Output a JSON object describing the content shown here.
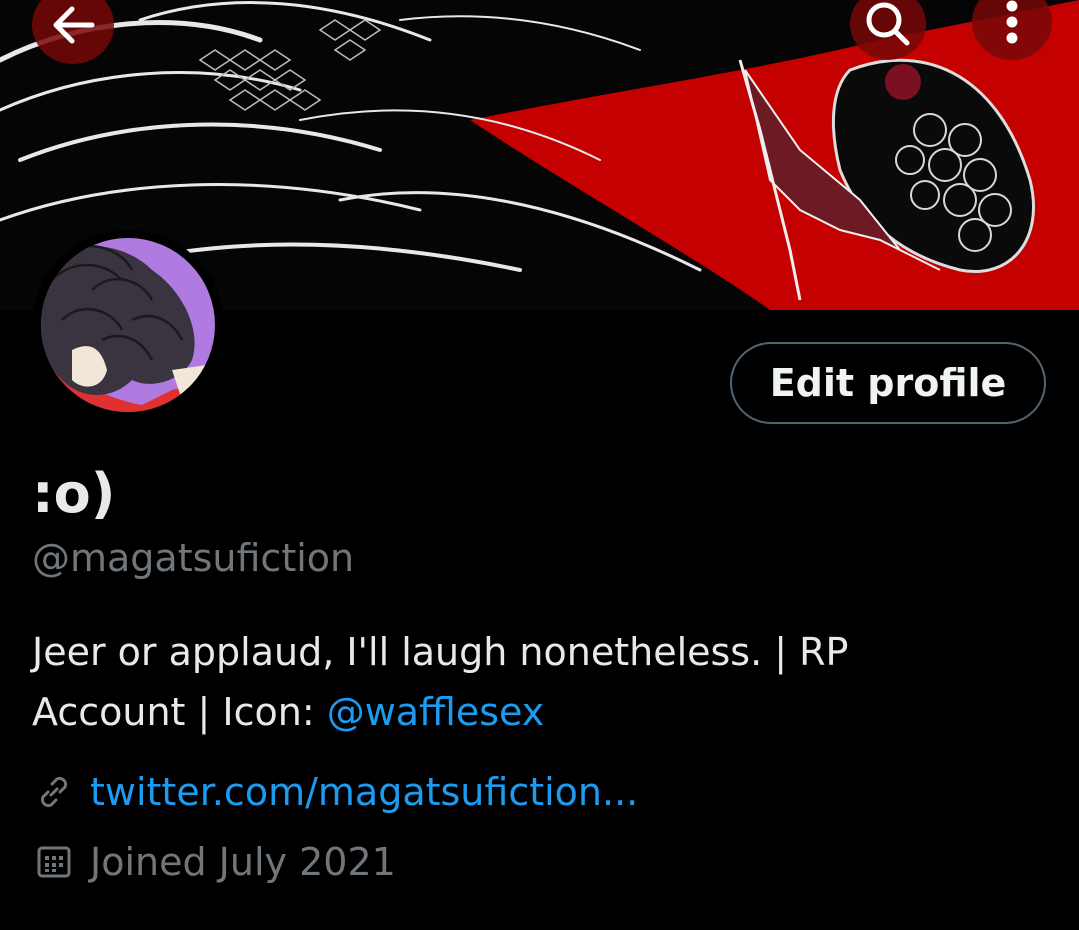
{
  "header": {
    "back_icon": "arrow-left-icon",
    "search_icon": "search-icon",
    "more_icon": "more-vertical-icon"
  },
  "colors": {
    "background": "#000000",
    "accent": "#1d9bf0",
    "muted": "#71767b",
    "banner_red": "#c40000"
  },
  "profile": {
    "edit_label": "Edit profile",
    "display_name": ":o)",
    "handle": "@magatsufiction",
    "bio_text_1": "Jeer or applaud, I'll laugh nonetheless. | RP",
    "bio_text_2": "Account | Icon: ",
    "bio_mention": "@wafflesex",
    "website": "twitter.com/magatsufiction...",
    "joined": "Joined July 2021"
  }
}
